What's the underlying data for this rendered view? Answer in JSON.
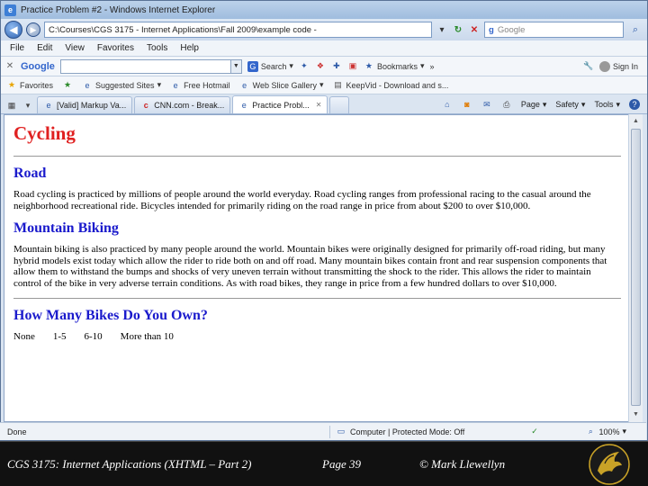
{
  "window": {
    "title": "Practice Problem #2 - Windows Internet Explorer"
  },
  "address_bar": {
    "url": "C:\\Courses\\CGS 3175 - Internet Applications\\Fall 2009\\example code -",
    "search_placeholder": "Google"
  },
  "menu": [
    "File",
    "Edit",
    "View",
    "Favorites",
    "Tools",
    "Help"
  ],
  "google_toolbar": {
    "logo": "Google",
    "search_label": "Search",
    "bookmarks_label": "Bookmarks",
    "more_label": "»",
    "sign_in_label": "Sign In"
  },
  "favorites_bar": {
    "favorites_label": "Favorites",
    "items": [
      "Suggested Sites",
      "Free Hotmail",
      "Web Slice Gallery",
      "KeepVid - Download and s..."
    ]
  },
  "tabs": [
    {
      "label": "[Valid] Markup Va...",
      "active": false
    },
    {
      "label": "CNN.com - Break...",
      "active": false
    },
    {
      "label": "Practice Probl...",
      "active": true
    }
  ],
  "command_bar": {
    "page_label": "Page",
    "safety_label": "Safety",
    "tools_label": "Tools"
  },
  "page": {
    "title": "Cycling",
    "sections": [
      {
        "heading": "Road",
        "text": "Road cycling is practiced by millions of people around the world everyday. Road cycling ranges from professional racing to the casual around the neighborhood recreational ride. Bicycles intended for primarily riding on the road range in price from about $200 to over $10,000."
      },
      {
        "heading": "Mountain Biking",
        "text": "Mountain biking is also practiced by many people around the world. Mountain bikes were originally designed for primarily off-road riding, but many hybrid models exist today which allow the rider to ride both on  and off road. Many mountain bikes contain front and rear suspension components that allow them to withstand the bumps and shocks of very uneven terrain without transmitting the shock to the rider. This allows the rider to maintain control of the bike in very adverse terrain conditions.  As with road bikes, they range in price from a few hundred dollars to over $10,000."
      }
    ],
    "question": "How Many Bikes Do You Own?",
    "options": [
      "None",
      "1-5",
      "6-10",
      "More than 10"
    ]
  },
  "status_bar": {
    "status": "Done",
    "zone": "Computer | Protected Mode: Off",
    "zoom": "100%"
  },
  "footer": {
    "course": "CGS 3175: Internet Applications (XHTML – Part 2)",
    "page": "Page 39",
    "author": "© Mark Llewellyn"
  }
}
